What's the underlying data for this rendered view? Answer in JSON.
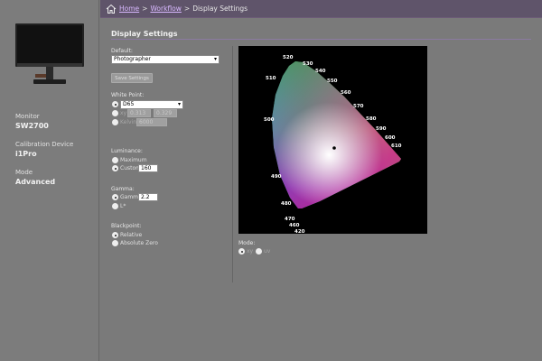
{
  "sidebar": {
    "monitor_label": "Monitor",
    "monitor_value": "SW2700",
    "calibration_label": "Calibration Device",
    "calibration_value": "i1Pro",
    "mode_label": "Mode",
    "mode_value": "Advanced"
  },
  "breadcrumb": {
    "home": "Home",
    "workflow": "Workflow",
    "current": "Display Settings",
    "sep": ">"
  },
  "main": {
    "title": "Display Settings",
    "default_label": "Default:",
    "default_value": "Photographer",
    "save_button": "Save Settings",
    "white_point_label": "White Point:",
    "white_point_select": "D65",
    "wp_xy_label": "xy",
    "wp_x": "0.313",
    "wp_y": "0.329",
    "wp_kelvin_label": "Kelvin",
    "wp_kelvin_value": "6000",
    "luminance_label": "Luminance:",
    "lum_max_label": "Maximum",
    "lum_custom_label": "Custom",
    "lum_custom_value": "160",
    "gamma_label": "Gamma:",
    "gamma_custom_label": "Gamma",
    "gamma_custom_value": "2.2",
    "gamma_lstar_label": "L*",
    "blackpoint_label": "Blackpoint:",
    "bp_relative_label": "Relative",
    "bp_absolute_label": "Absolute Zero",
    "mode_label": "Mode:",
    "mode_xy_label": "xy",
    "mode_uv_label": "uv"
  },
  "gamut": {
    "wavelengths": [
      "520",
      "530",
      "540",
      "550",
      "560",
      "570",
      "580",
      "590",
      "600",
      "610",
      "510",
      "500",
      "490",
      "480",
      "470",
      "460",
      "420"
    ]
  }
}
